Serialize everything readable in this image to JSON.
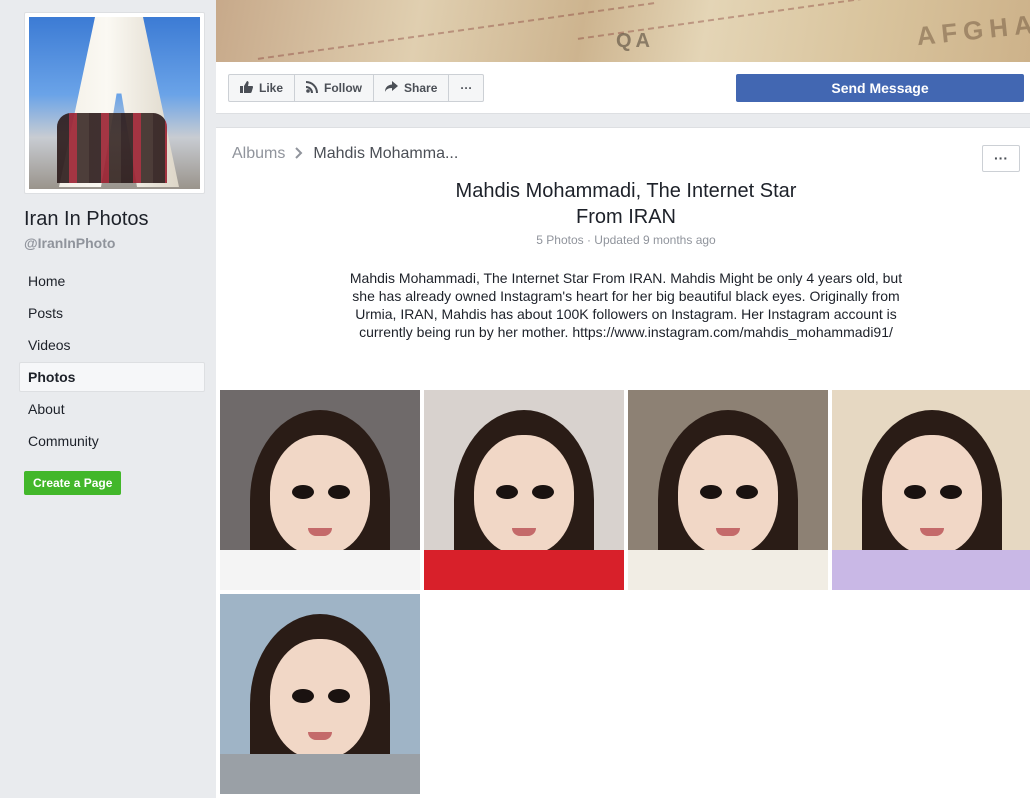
{
  "page": {
    "name": "Iran In Photos",
    "handle": "@IranInPhoto"
  },
  "sidebar": {
    "items": [
      {
        "label": "Home"
      },
      {
        "label": "Posts"
      },
      {
        "label": "Videos"
      },
      {
        "label": "Photos",
        "active": true
      },
      {
        "label": "About"
      },
      {
        "label": "Community"
      }
    ],
    "create_page": "Create a Page"
  },
  "cover": {
    "map_label_1": "AFGHANISTAN",
    "map_label_2": "QA"
  },
  "actions": {
    "like": "Like",
    "follow": "Follow",
    "share": "Share",
    "more": "···",
    "send_message": "Send Message"
  },
  "album": {
    "breadcrumb_root": "Albums",
    "breadcrumb_current": "Mahdis Mohamma...",
    "more": "···",
    "title_line1": "Mahdis Mohammadi, The Internet Star",
    "title_line2": "From IRAN",
    "meta": "5 Photos · Updated 9 months ago",
    "description_lines": [
      "Mahdis Mohammadi, The Internet Star From IRAN. Mahdis Might be only 4 years old, but",
      "she has already owned Instagram's heart for her big beautiful black eyes. Originally from",
      "Urmia, IRAN, Mahdis has about 100K followers on Instagram. Her Instagram account is",
      "currently being run by her mother. https://www.instagram.com/mahdis_mohammadi91/"
    ],
    "photos": [
      {
        "bg": "#6f6a6a",
        "cloth": "#f4f4f4"
      },
      {
        "bg": "#d8d2ce",
        "cloth": "#d8202a"
      },
      {
        "bg": "#8d8174",
        "cloth": "#f1ede4"
      },
      {
        "bg": "#e6d8c2",
        "cloth": "#c9b8e6"
      },
      {
        "bg": "#9fb4c6",
        "cloth": "#9aa0a6"
      }
    ]
  },
  "colors": {
    "brand_blue": "#4267b2",
    "create_green": "#42b72a",
    "background": "#e9ebee"
  }
}
